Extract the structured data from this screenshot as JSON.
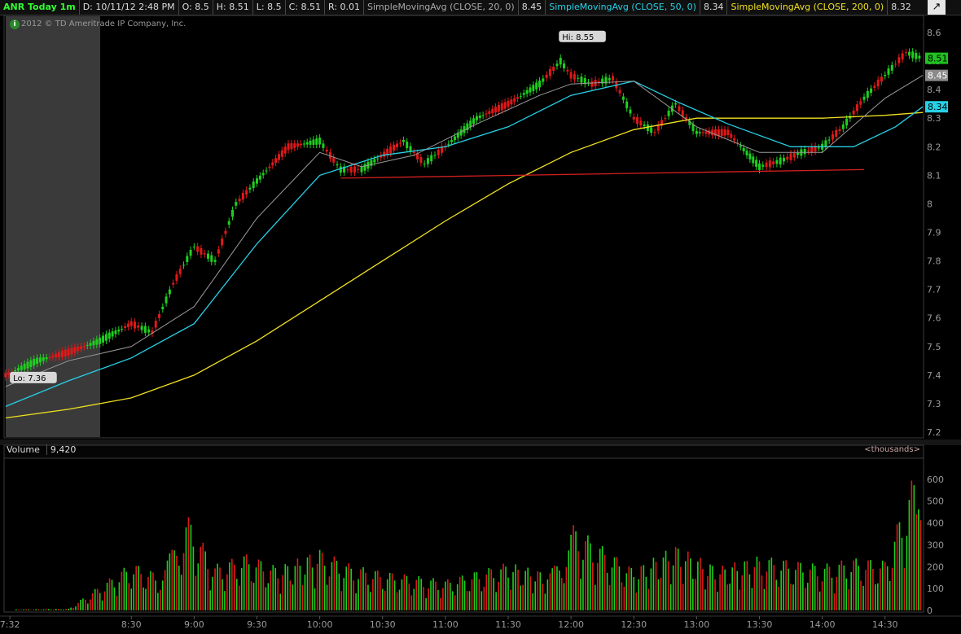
{
  "header": {
    "symbol": "ANR Today 1m",
    "date": "D: 10/11/12 2:48 PM",
    "open": "O: 8.5",
    "high": "H: 8.51",
    "low": "L: 8.5",
    "close": "C: 8.51",
    "range": "R: 0.01",
    "sma20_label": "SimpleMovingAvg (CLOSE, 20, 0)",
    "sma20_value": "8.45",
    "sma50_label": "SimpleMovingAvg (CLOSE, 50, 0)",
    "sma50_value": "8.34",
    "sma200_label": "SimpleMovingAvg (CLOSE, 200, 0)",
    "sma200_value": "8.32",
    "tool_icon": "draw-tool-icon"
  },
  "copyright": "2012 © TD Ameritrade IP Company, Inc.",
  "volume_panel": {
    "label": "Volume",
    "value": "9,420",
    "units": "<thousands>"
  },
  "colors": {
    "up": "#1ed01e",
    "down": "#e01818",
    "sma20": "#9a9a9a",
    "sma50": "#27d0e6",
    "sma200": "#f0e020",
    "trendline": "#d42020"
  },
  "chart_data": {
    "type": "candlestick",
    "price": {
      "ylim": [
        7.18,
        8.66
      ],
      "yticks": [
        "8.6",
        "8.5",
        "8.4",
        "8.3",
        "8.2",
        "8.1",
        "8",
        "7.9",
        "7.8",
        "7.7",
        "7.6",
        "7.5",
        "7.4",
        "7.3",
        "7.2"
      ],
      "hi_label": "Hi: 8.55",
      "lo_label": "Lo: 7.36",
      "last_price": "8.51",
      "sma20_last": "8.45",
      "sma50_last": "8.34",
      "premarket_shaded": true,
      "series": {
        "price": {
          "x": [
            "7:30",
            "7:45",
            "8:00",
            "8:15",
            "8:30",
            "8:40",
            "8:50",
            "9:00",
            "9:10",
            "9:20",
            "9:30",
            "9:45",
            "10:00",
            "10:10",
            "10:20",
            "10:40",
            "10:50",
            "11:00",
            "11:15",
            "11:30",
            "11:45",
            "11:55",
            "12:00",
            "12:10",
            "12:20",
            "12:30",
            "12:40",
            "12:50",
            "13:00",
            "13:15",
            "13:30",
            "13:40",
            "13:50",
            "14:00",
            "14:10",
            "14:20",
            "14:30",
            "14:40",
            "14:48"
          ],
          "values": [
            7.4,
            7.45,
            7.48,
            7.52,
            7.58,
            7.55,
            7.72,
            7.85,
            7.8,
            8.0,
            8.08,
            8.2,
            8.22,
            8.12,
            8.12,
            8.22,
            8.14,
            8.2,
            8.3,
            8.35,
            8.42,
            8.5,
            8.45,
            8.42,
            8.44,
            8.3,
            8.25,
            8.35,
            8.25,
            8.25,
            8.13,
            8.15,
            8.18,
            8.2,
            8.27,
            8.37,
            8.45,
            8.53,
            8.51
          ]
        },
        "sma20": {
          "x": [
            "7:30",
            "8:00",
            "8:30",
            "9:00",
            "9:30",
            "10:00",
            "10:20",
            "10:45",
            "11:15",
            "11:45",
            "12:00",
            "12:30",
            "13:00",
            "13:30",
            "14:00",
            "14:30",
            "14:48"
          ],
          "values": [
            7.36,
            7.45,
            7.5,
            7.64,
            7.95,
            8.18,
            8.13,
            8.17,
            8.28,
            8.38,
            8.42,
            8.43,
            8.27,
            8.18,
            8.18,
            8.37,
            8.45
          ]
        },
        "sma50": {
          "x": [
            "7:30",
            "8:00",
            "8:30",
            "9:00",
            "9:30",
            "10:00",
            "10:30",
            "11:00",
            "11:30",
            "12:00",
            "12:30",
            "12:50",
            "13:15",
            "13:45",
            "14:15",
            "14:35",
            "14:48"
          ],
          "values": [
            7.29,
            7.38,
            7.46,
            7.58,
            7.86,
            8.1,
            8.17,
            8.2,
            8.27,
            8.38,
            8.43,
            8.36,
            8.28,
            8.2,
            8.2,
            8.27,
            8.34
          ]
        },
        "sma200": {
          "x": [
            "7:30",
            "8:00",
            "8:30",
            "9:00",
            "9:30",
            "10:00",
            "10:30",
            "11:00",
            "11:30",
            "12:00",
            "12:30",
            "13:00",
            "13:30",
            "14:00",
            "14:30",
            "14:48"
          ],
          "values": [
            7.25,
            7.28,
            7.32,
            7.4,
            7.52,
            7.66,
            7.8,
            7.94,
            8.07,
            8.18,
            8.26,
            8.3,
            8.3,
            8.3,
            8.31,
            8.32
          ]
        },
        "support_line": {
          "x": [
            "10:10",
            "14:20"
          ],
          "values": [
            8.09,
            8.12
          ]
        }
      }
    },
    "volume": {
      "ylim": [
        0,
        700
      ],
      "yticks": [
        "600",
        "500",
        "400",
        "300",
        "200",
        "100",
        "0"
      ],
      "ylabel": "<thousands>",
      "bars": {
        "x": [
          "7:35",
          "8:00",
          "8:30",
          "8:45",
          "8:55",
          "9:10",
          "9:25",
          "9:40",
          "10:00",
          "10:15",
          "10:30",
          "11:00",
          "11:30",
          "11:50",
          "12:00",
          "12:30",
          "12:50",
          "13:10",
          "13:30",
          "14:00",
          "14:15",
          "14:30",
          "14:45",
          "14:48"
        ],
        "values": [
          5,
          8,
          220,
          160,
          470,
          210,
          260,
          200,
          280,
          210,
          180,
          140,
          220,
          170,
          400,
          190,
          300,
          200,
          250,
          210,
          240,
          230,
          660,
          310
        ]
      }
    },
    "xticks": [
      "7:32",
      "8:30",
      "9:00",
      "9:30",
      "10:00",
      "10:30",
      "11:00",
      "11:30",
      "12:00",
      "12:30",
      "13:00",
      "13:30",
      "14:00",
      "14:30"
    ]
  }
}
